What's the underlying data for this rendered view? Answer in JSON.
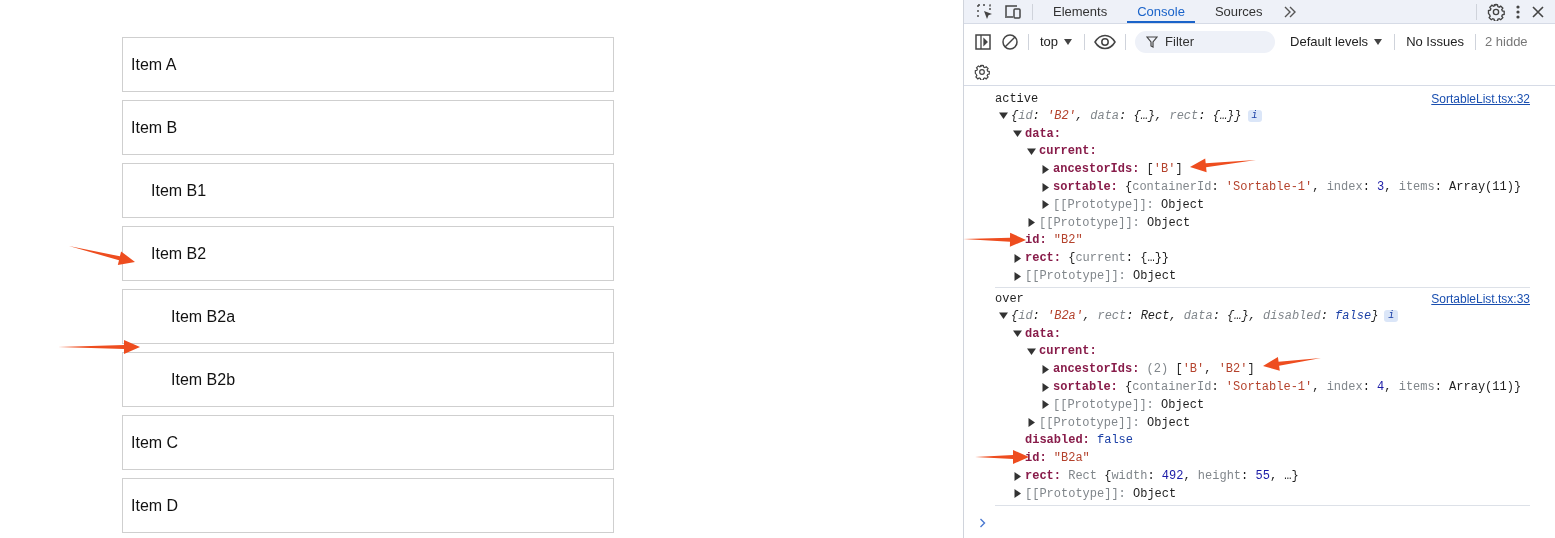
{
  "sortable_list": {
    "items": [
      {
        "label": "Item A"
      },
      {
        "label": "Item B",
        "children": [
          {
            "label": "Item B1"
          },
          {
            "label": "Item B2",
            "children": [
              {
                "label": "Item B2a"
              },
              {
                "label": "Item B2b"
              }
            ]
          }
        ]
      },
      {
        "label": "Item C"
      },
      {
        "label": "Item D"
      }
    ]
  },
  "devtools": {
    "tabs": [
      {
        "label": "Elements",
        "selected": false
      },
      {
        "label": "Console",
        "selected": true
      },
      {
        "label": "Sources",
        "selected": false
      }
    ],
    "toolbar": {
      "context": "top",
      "filter": {
        "placeholder": "Filter"
      },
      "levels": "Default levels",
      "issues": "No Issues",
      "hidden": "2 hidde"
    },
    "console": {
      "entries": [
        {
          "message": "active",
          "source": "SortableList.tsx:32",
          "tree": {
            "summary": true,
            "badge": "i",
            "expanded": true,
            "value": "{id: 'B2', data: {…}, rect: {…}}",
            "children": [
              {
                "key": "data:",
                "dimmed": false,
                "expanded": true,
                "children": [
                  {
                    "key": "current:",
                    "dimmed": false,
                    "expanded": true,
                    "children": [
                      {
                        "key": "ancestorIds:",
                        "dimmed": false,
                        "expanded": false,
                        "value": "['B']"
                      },
                      {
                        "key": "sortable:",
                        "dimmed": false,
                        "expanded": false,
                        "value": "{containerId: 'Sortable-1', index: 3, items: Array(11)}"
                      },
                      {
                        "key": "[[Prototype]]:",
                        "dimmed": true,
                        "expanded": false,
                        "value": "Object"
                      }
                    ]
                  },
                  {
                    "key": "[[Prototype]]:",
                    "dimmed": true,
                    "expanded": false,
                    "value": "Object"
                  }
                ]
              },
              {
                "key": "id:",
                "dimmed": false,
                "value": "\"B2\""
              },
              {
                "key": "rect:",
                "dimmed": false,
                "expanded": false,
                "value": "{current: {…}}"
              },
              {
                "key": "[[Prototype]]:",
                "dimmed": true,
                "expanded": false,
                "value": "Object"
              }
            ]
          }
        },
        {
          "message": "over",
          "source": "SortableList.tsx:33",
          "tree": {
            "summary": true,
            "badge": "i",
            "expanded": true,
            "value": "{id: 'B2a', rect: Rect, data: {…}, disabled: false}",
            "children": [
              {
                "key": "data:",
                "dimmed": false,
                "expanded": true,
                "children": [
                  {
                    "key": "current:",
                    "dimmed": false,
                    "expanded": true,
                    "children": [
                      {
                        "key": "ancestorIds:",
                        "dimmed": false,
                        "expanded": false,
                        "value": "(2) ['B', 'B2']"
                      },
                      {
                        "key": "sortable:",
                        "dimmed": false,
                        "expanded": false,
                        "value": "{containerId: 'Sortable-1', index: 4, items: Array(11)}"
                      },
                      {
                        "key": "[[Prototype]]:",
                        "dimmed": true,
                        "expanded": false,
                        "value": "Object"
                      }
                    ]
                  },
                  {
                    "key": "[[Prototype]]:",
                    "dimmed": true,
                    "expanded": false,
                    "value": "Object"
                  }
                ]
              },
              {
                "key": "disabled:",
                "dimmed": false,
                "value": "false"
              },
              {
                "key": "id:",
                "dimmed": false,
                "value": "\"B2a\""
              },
              {
                "key": "rect:",
                "dimmed": false,
                "expanded": false,
                "value": "Rect {width: 492, height: 55, …}"
              },
              {
                "key": "[[Prototype]]:",
                "dimmed": true,
                "expanded": false,
                "value": "Object"
              }
            ]
          }
        }
      ]
    }
  }
}
